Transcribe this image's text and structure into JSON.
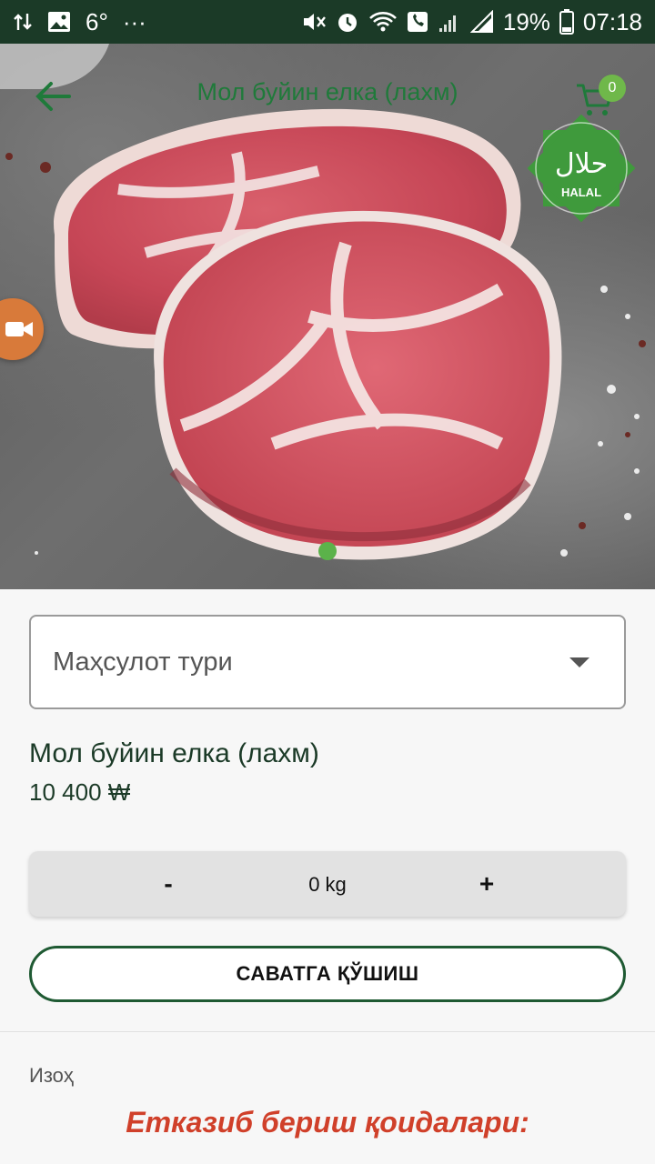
{
  "status_bar": {
    "temperature": "6°",
    "more": "···",
    "battery_percent": "19%",
    "time": "07:18"
  },
  "header": {
    "title": "Мол буйин елка (лахм)",
    "cart_count": "0"
  },
  "halal_badge": {
    "arabic": "حلال",
    "label": "HALAL"
  },
  "gallery": {
    "active_index": 0,
    "total": 1
  },
  "product": {
    "type_select_placeholder": "Маҳсулот тури",
    "name": "Мол буйин елка (лахм)",
    "price": "10 400 ₩"
  },
  "quantity": {
    "minus_label": "-",
    "value": "0 kg",
    "plus_label": "+"
  },
  "actions": {
    "add_to_cart": "САВАТГА ҚЎШИШ"
  },
  "details": {
    "note_label": "Изоҳ",
    "delivery_heading": "Етказиб бериш қоидалари:"
  },
  "colors": {
    "status_bar": "#1b3a27",
    "brand_green": "#1f7a3a",
    "badge_green": "#6fb84a",
    "accent_red": "#d0402a"
  }
}
